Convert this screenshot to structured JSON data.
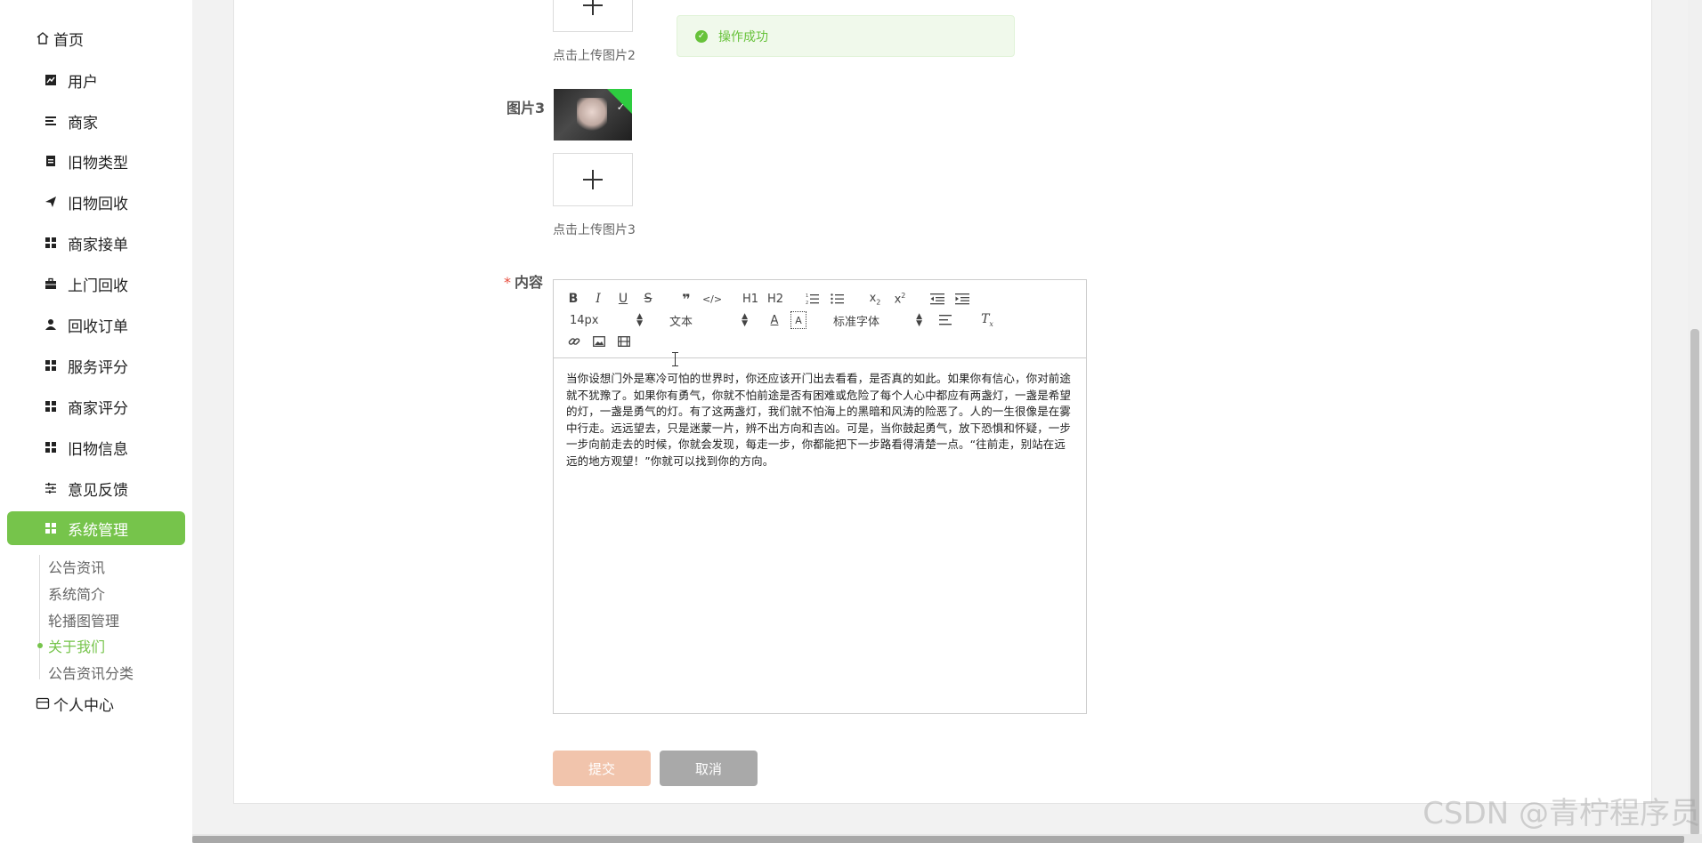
{
  "sidebar": {
    "home_label": "首页",
    "items": [
      {
        "label": "用户",
        "icon": "chart-icon"
      },
      {
        "label": "商家",
        "icon": "list-icon"
      },
      {
        "label": "旧物类型",
        "icon": "clipboard-icon"
      },
      {
        "label": "旧物回收",
        "icon": "send-icon"
      },
      {
        "label": "商家接单",
        "icon": "grid-icon"
      },
      {
        "label": "上门回收",
        "icon": "briefcase-icon"
      },
      {
        "label": "回收订单",
        "icon": "user-icon"
      },
      {
        "label": "服务评分",
        "icon": "grid-icon"
      },
      {
        "label": "商家评分",
        "icon": "grid-icon"
      },
      {
        "label": "旧物信息",
        "icon": "grid-icon"
      },
      {
        "label": "意见反馈",
        "icon": "sliders-icon"
      },
      {
        "label": "系统管理",
        "icon": "grid-icon",
        "active": true
      }
    ],
    "sub_items": [
      {
        "label": "公告资讯"
      },
      {
        "label": "系统简介"
      },
      {
        "label": "轮播图管理"
      },
      {
        "label": "关于我们",
        "active": true
      },
      {
        "label": "公告资讯分类"
      }
    ],
    "personal_label": "个人中心",
    "accent_color": "#76c44b"
  },
  "form": {
    "upload2_hint": "点击上传图片2",
    "image3_label": "图片3",
    "upload3_hint": "点击上传图片3",
    "content_label": "内容",
    "required_mark": "*"
  },
  "toast": {
    "message": "操作成功",
    "color": "#67c23a"
  },
  "editor": {
    "toolbar": {
      "font_size": "14px",
      "paragraph": "文本",
      "font_family": "标准字体",
      "h1": "H1",
      "h2": "H2"
    },
    "content": "当你设想门外是寒冷可怕的世界时，你还应该开门出去看看，是否真的如此。如果你有信心，你对前途就不犹豫了。如果你有勇气，你就不怕前途是否有困难或危险了每个人心中都应有两盏灯，一盏是希望的灯，一盏是勇气的灯。有了这两盏灯，我们就不怕海上的黑暗和风涛的险恶了。人的一生很像是在雾中行走。远远望去，只是迷蒙一片，辨不出方向和吉凶。可是，当你鼓起勇气，放下恐惧和怀疑，一步一步向前走去的时候，你就会发现，每走一步，你都能把下一步路看得清楚一点。“往前走，别站在远远的地方观望！”你就可以找到你的方向。"
  },
  "buttons": {
    "submit": "提交",
    "cancel": "取消"
  },
  "watermark": "CSDN @青柠程序员"
}
